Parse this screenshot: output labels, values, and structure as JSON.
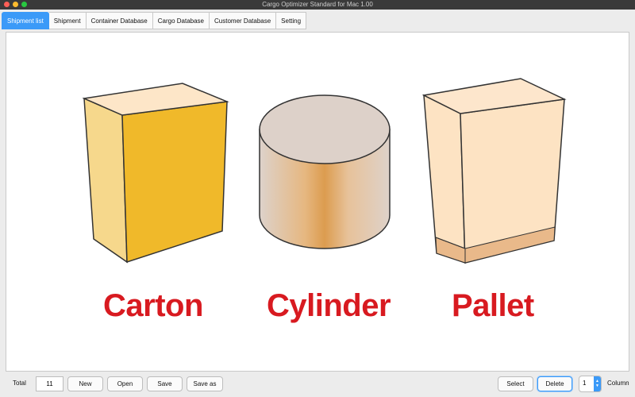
{
  "window": {
    "title": "Cargo Optimizer Standard for Mac 1.00"
  },
  "tabs": [
    {
      "label": "Shipment list",
      "active": true
    },
    {
      "label": "Shipment"
    },
    {
      "label": "Container Database"
    },
    {
      "label": "Cargo Database"
    },
    {
      "label": "Customer Database"
    },
    {
      "label": "Setting"
    }
  ],
  "canvas": {
    "items": [
      {
        "label": "Carton",
        "icon": "carton-box-icon"
      },
      {
        "label": "Cylinder",
        "icon": "cylinder-icon"
      },
      {
        "label": "Pallet",
        "icon": "pallet-box-icon"
      }
    ],
    "label_color": "#d81a20"
  },
  "bottom": {
    "total_label": "Total",
    "total_value": "11",
    "new_label": "New",
    "open_label": "Open",
    "save_label": "Save",
    "save_as_label": "Save as",
    "select_label": "Select",
    "delete_label": "Delete",
    "column_value": "1",
    "column_label": "Column"
  },
  "colors": {
    "accent": "#3b9af8",
    "carton": "#f0b92a",
    "cylinder": "#dda15a",
    "pallet": "#fde3c3"
  }
}
